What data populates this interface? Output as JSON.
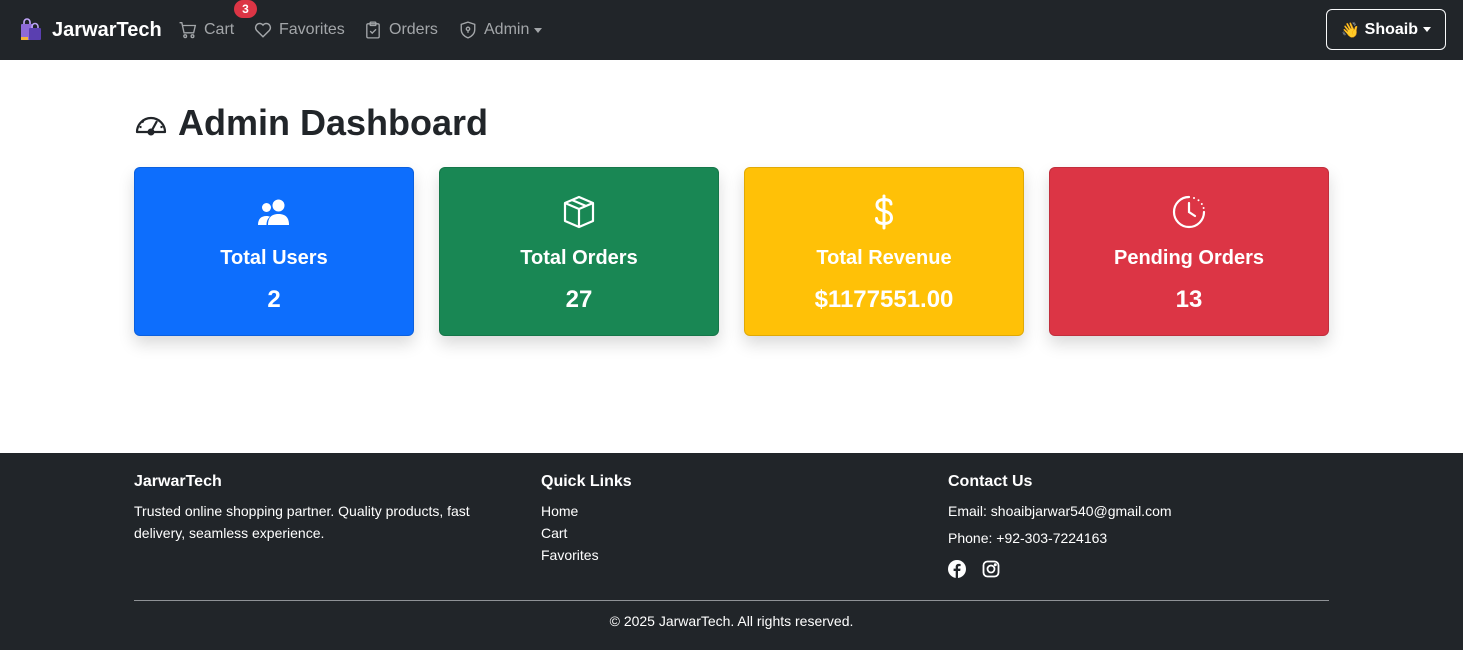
{
  "navbar": {
    "brand": "JarwarTech",
    "links": {
      "cart": "Cart",
      "favorites": "Favorites",
      "orders": "Orders",
      "admin": "Admin"
    },
    "cart_badge": "3",
    "user_label": "Shoaib",
    "user_emoji": "👋"
  },
  "page": {
    "title": "Admin Dashboard"
  },
  "cards": [
    {
      "title": "Total Users",
      "value": "2",
      "color": "#0d6efd",
      "icon": "people-icon"
    },
    {
      "title": "Total Orders",
      "value": "27",
      "color": "#198754",
      "icon": "box-icon"
    },
    {
      "title": "Total Revenue",
      "value": "$1177551.00",
      "color": "#ffc107",
      "icon": "dollar-icon"
    },
    {
      "title": "Pending Orders",
      "value": "13",
      "color": "#dc3545",
      "icon": "clock-history-icon"
    }
  ],
  "footer": {
    "about": {
      "heading": "JarwarTech",
      "line1": "Trusted online shopping partner. Quality products, fast",
      "line2": "delivery, seamless experience."
    },
    "quick_links": {
      "heading": "Quick Links",
      "items": [
        "Home",
        "Cart",
        "Favorites"
      ]
    },
    "contact": {
      "heading": "Contact Us",
      "email": "Email: shoaibjarwar540@gmail.com",
      "phone": "Phone: +92-303-7224163",
      "social_icons": [
        "facebook-icon",
        "instagram-icon"
      ]
    },
    "copyright": "© 2025 JarwarTech. All rights reserved."
  }
}
